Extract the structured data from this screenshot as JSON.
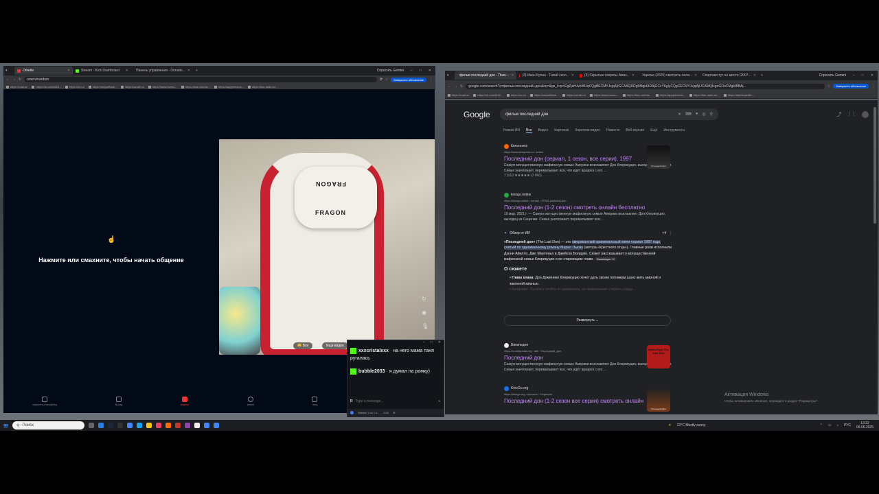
{
  "left_browser": {
    "tabs": [
      {
        "label": "Ometle",
        "active": true
      },
      {
        "label": "Stream - Kick Dashboard"
      },
      {
        "label": "Панель управления - Donatio..."
      }
    ],
    "gemini_label": "Спросить Gemini",
    "url": "ometv/random",
    "update_label": "Завершить обновление",
    "bookmarks": [
      "https://roall.ru/",
      "https://vk.com/id18...",
      "https://vz.ru/",
      "https://seriyaRank...",
      "https://ocraft.ru/",
      "https://www.tomsu...",
      "https://kick.com/as...",
      "https://appjeenstva...",
      "https://fine-radio.ru/...",
      "https://dashboardlin..."
    ]
  },
  "ome": {
    "start_text": "Нажмите или смахните, чтобы начать общение",
    "cam_labels": [
      "FRAGON",
      "FRAGON"
    ],
    "overlay_chip_1": "Все",
    "overlay_chip_2": "Ищи видео",
    "nav": [
      "изменить интерфейсу",
      "Выход",
      "модели",
      "живой",
      "Чаты"
    ]
  },
  "chat": {
    "messages": [
      {
        "nick": "xxxcristalxxx",
        "text": "на него мама таня ругалась"
      },
      {
        "nick": "bubble2033",
        "text": "я думал на ромку)"
      }
    ],
    "input_placeholder": "Type a message...",
    "footer": "Stream 1 по 1 к...",
    "footer_count": "0:00"
  },
  "right_browser": {
    "tabs": [
      {
        "label": "фильм последний дон - Поис...",
        "active": true
      },
      {
        "label": "(3) Иван Купан - Тихий скол..."
      },
      {
        "label": "(3) Скрытые секреты Амаз..."
      },
      {
        "label": "Ущелье (2025) смотреть онла..."
      },
      {
        "label": "Спартаки тут не место (2007..."
      }
    ],
    "gemini_label": "Спросить Gemini",
    "url": "google.com/search?q=фильм+последний+дон&oq=&gs_lcrp=EgZjaHJvbWUqCQgBECMYJxjqAjIGCAAQRRg5MgkIARAjGCcY6gIyCQgCECMYJxjqAjIJCAMQIxgnGOoCMgkIBBAj...",
    "update_label": "Завершить обновление",
    "bookmarks": [
      "https://roall.ru/",
      "https://vk.com/id18...",
      "https://vz.ru/",
      "https://seriyaRank...",
      "https://ocraft.ru/",
      "https://www.tomsu...",
      "https://kick.com/as...",
      "https://appjeenstva...",
      "https://fine-radio.ru/...",
      "https://dashboardlin..."
    ]
  },
  "google": {
    "logo": "Google",
    "query": "фильм последний дон",
    "tabs": [
      "Режим ИИ",
      "Все",
      "Видео",
      "Картинки",
      "Короткие видео",
      "Новости",
      "Веб-версия",
      "Ещё",
      "Инструменты"
    ],
    "results": [
      {
        "site": "Кинопоиск",
        "url": "https://www.kinopoisk.ru › series",
        "title": "Последний дон (сериал, 1 сезон, все серии), 1997",
        "snippet": "Самую могущественную мафиозную семью Америки возглавляет Дон Клерикуцио, выходец из Сицилии. Семья уничтожает, перемалывает все, что идёт вразрез с его ...",
        "rating": "7.5/10 ★★★★★ (3 860)"
      },
      {
        "site": "kinogo.online",
        "url": "https://kinogo.online › serialy › 37044-poslednij-don",
        "title": "Последний дон (1-2 сезон) смотреть онлайн бесплатно",
        "snippet": "19 мар. 2021 г. — Самую могущественную мафиозную семью Америки возглавляет Дон Клерикуцио, выходец из Сицилии. Семья уничтожает, перемалывает все..."
      }
    ],
    "ai": {
      "header": "Обзор от ИИ",
      "count": "+4",
      "p1_bold": "«Последний дон»",
      "p1_a": " (The Last Don) — это ",
      "p1_hl": "американский криминальный мини-сериал 1997 года, снятый по одноименному роману Марио Пьюзо",
      "p1_b": " (автора «Крестного отца»). Главные роли исполнили Дэнни Айелло, Джо Мантенья и Джейсон Болдуин. Сюжет рассказывает о могущественной мафиозной семье Клерикуцио и ее стареющем главе.",
      "chip": "Википедия +2",
      "plot_heading": "О сюжете",
      "bullet_bold": "Глава клана",
      "bullet_text": ": Дон Доменико Клерикуцио хочет дать своим потомкам шанс жить мирной и законной жизнью.",
      "bullet2": "Конфликт: Пытаясь отойти от криминала, он приказывает стереть следы..."
    },
    "expand_label": "Развернуть",
    "results2": [
      {
        "site": "Википедия",
        "url": "https://ru.wikipedia.org › wiki › Последний_дон",
        "title": "Последний дон",
        "snippet": "Самую могущественную мафиозную семью Америки возглавляет Дон Клерикуцио, выходец из Сицилии. Семья уничтожает, перемалывает все, что идёт вразрез с его ..."
      },
      {
        "site": "KinoGo.org",
        "url": "https://kinogo.org › kinoserv › Сериалы",
        "title": "Последний дон (1-2 сезон все серии) смотреть онлайн"
      }
    ],
    "thumb_texts": [
      "Последний Дон",
      "Mario Puzo The Last Don",
      "Последний Дон"
    ]
  },
  "activate": {
    "line1": "Активация Windows",
    "line2": "Чтобы активировать Windows, перейдите в раздел \"Параметры\"."
  },
  "taskbar": {
    "search": "Поиск",
    "weather": "22°C  Mostly sunny",
    "lang": "РУС",
    "time": "13:22",
    "date": "09.06.2025"
  }
}
